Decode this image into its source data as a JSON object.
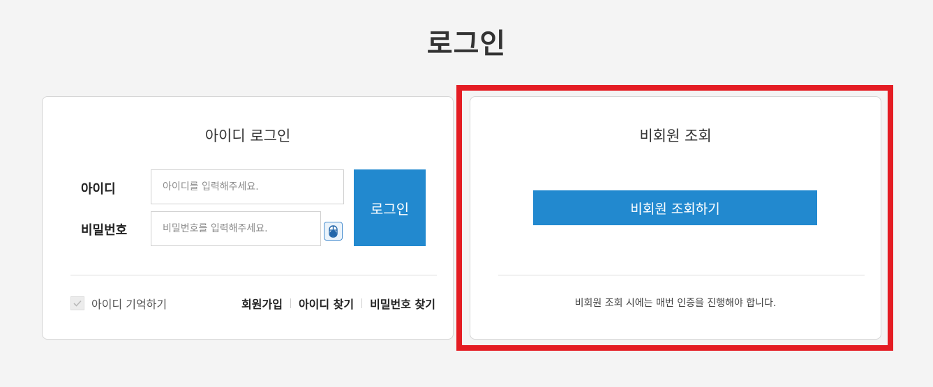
{
  "page": {
    "title": "로그인"
  },
  "login": {
    "title": "아이디 로그인",
    "id_label": "아이디",
    "id_placeholder": "아이디를 입력해주세요.",
    "pw_label": "비밀번호",
    "pw_placeholder": "비밀번호를 입력해주세요.",
    "login_button": "로그인",
    "remember_label": "아이디 기억하기",
    "links": [
      "회원가입",
      "아이디 찾기",
      "비밀번호 찾기"
    ]
  },
  "guest": {
    "title": "비회원 조회",
    "button": "비회원 조회하기",
    "note": "비회원 조회 시에는 매번 인증을 진행해야 합니다."
  },
  "colors": {
    "accent": "#2289cf",
    "highlight": "#e41c23"
  }
}
